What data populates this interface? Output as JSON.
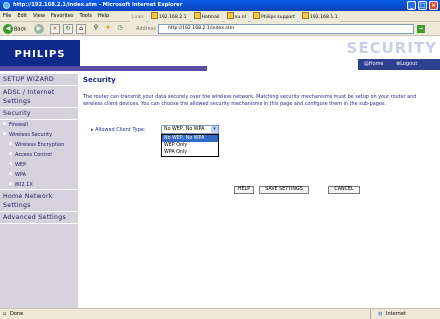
{
  "window": {
    "title": "http://192.168.2.1/index.stm - Microsoft Internet Explorer"
  },
  "menu": [
    "File",
    "Edit",
    "View",
    "Favorites",
    "Tools",
    "Help"
  ],
  "links": {
    "label": "Links",
    "items": [
      "192.168.2.1",
      "Hotmail",
      "nu.nl",
      "Philips support",
      "192.168.1.1"
    ]
  },
  "toolbar": {
    "back": "Back",
    "address_label": "Address",
    "address": "http://192.168.2.1/index.stm",
    "go": "Go"
  },
  "brand": {
    "logo": "PHILIPS",
    "section_word": "SECURITY",
    "home": "Home",
    "logout": "Logout"
  },
  "sidebar": {
    "setup_wizard": "SETUP WIZARD",
    "adsl": "ADSL / Internet Settings",
    "security": "Security",
    "firewall": "Firewall",
    "wireless_security": "Wireless Security",
    "wireless_encryption": "Wireless Encryption",
    "access_control": "Access Control",
    "wep": "WEP",
    "wpa": "WPA",
    "ieee": "802.1X",
    "home_network": "Home Network Settings",
    "advanced": "Advanced Settings"
  },
  "main": {
    "title": "Security",
    "description": "The router can transmit your data securely over the wireless network. Matching security mechanisms must be setup on your router and wireless client devices. You can choose the allowed security mechanisms in this page and configure them in the sub-pages.",
    "field_label": "Allowed Client Type:",
    "selected": "No WEP, No WPA",
    "options": [
      "No WEP, No WPA",
      "WEP Only",
      "WPA Only"
    ],
    "help": "HELP",
    "save": "SAVE SETTINGS",
    "cancel": "CANCEL"
  },
  "status": {
    "left": "Done",
    "right": "Internet"
  }
}
